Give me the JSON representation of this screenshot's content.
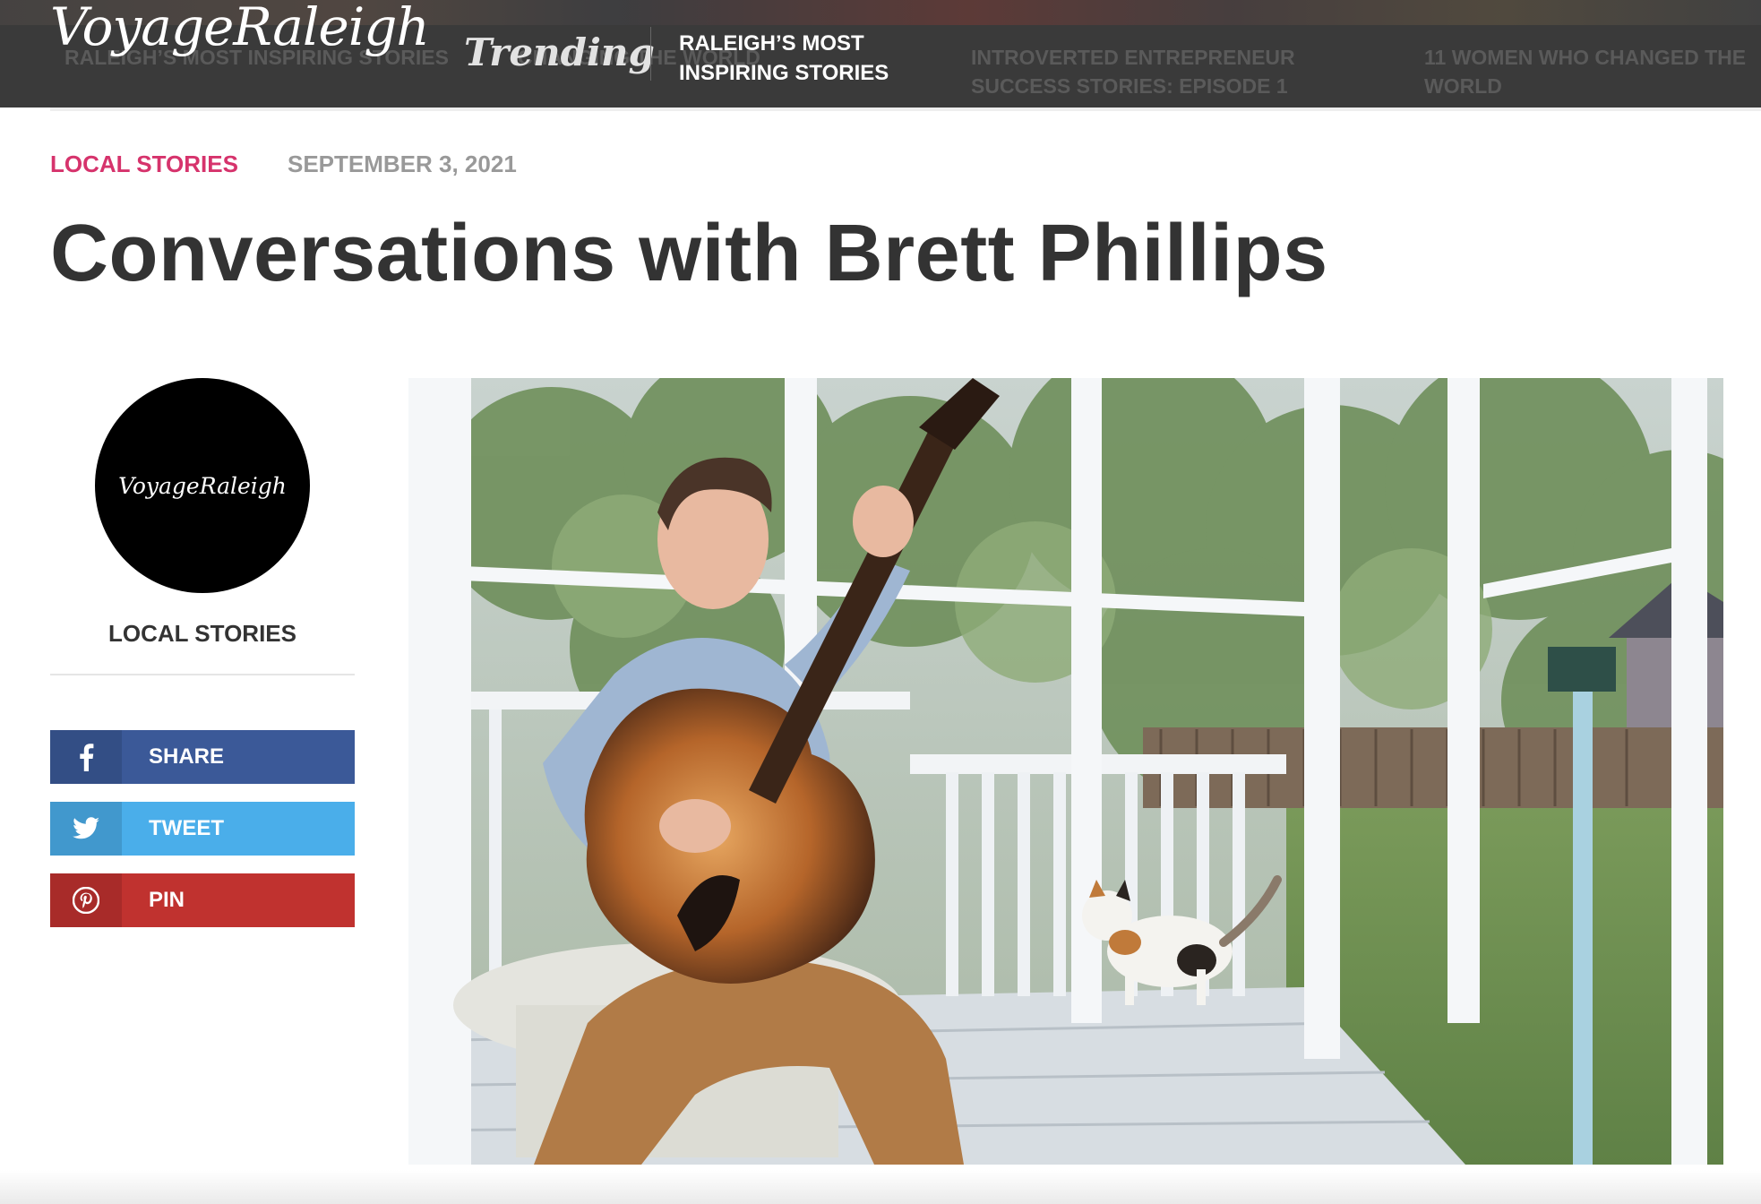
{
  "topbar": {
    "logo": "VoyageRaleigh",
    "trending_label": "Trending",
    "active_story": "RALEIGH’S MOST INSPIRING STORIES",
    "ticker": [
      "RALEIGH’S MOST INSPIRING STORIES",
      "CHANGING THE WORLD",
      "INTROVERTED ENTREPRENEUR SUCCESS STORIES: EPISODE 1",
      "11 WOMEN WHO CHANGED THE WORLD"
    ]
  },
  "article": {
    "category": "LOCAL STORIES",
    "date": "SEPTEMBER 3, 2021",
    "title": "Conversations with Brett Phillips"
  },
  "sidebar": {
    "avatar_text": "VoyageRaleigh",
    "category": "LOCAL STORIES",
    "share_buttons": [
      {
        "label": "SHARE",
        "icon": "facebook-icon",
        "color": "#3b5998"
      },
      {
        "label": "TWEET",
        "icon": "twitter-icon",
        "color": "#4aaeea"
      },
      {
        "label": "PIN",
        "icon": "pinterest-icon",
        "color": "#c0322f"
      }
    ]
  },
  "colors": {
    "accent": "#d6336c",
    "topbar": "#3a3a3a"
  }
}
